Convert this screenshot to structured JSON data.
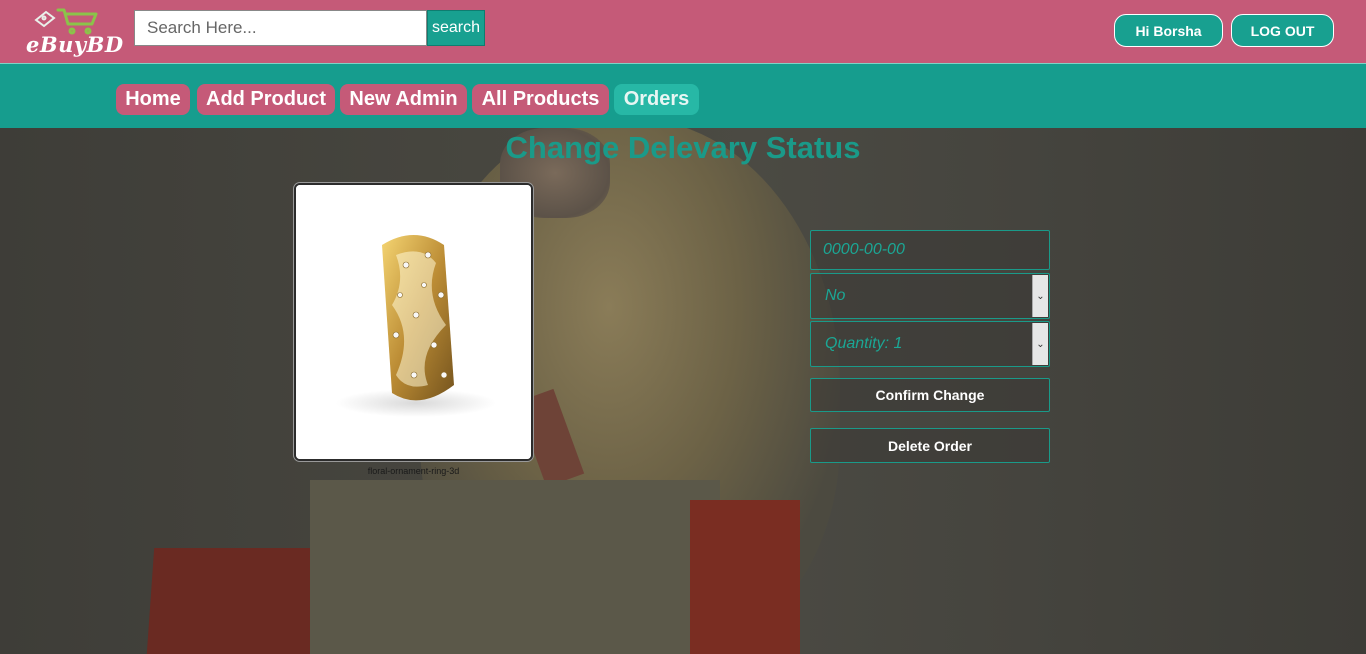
{
  "header": {
    "logo_text": "eBuyBD",
    "search": {
      "placeholder": "Search Here...",
      "button_label": "search"
    },
    "greeting": "Hi Borsha",
    "logout_label": "LOG OUT"
  },
  "nav": {
    "items": [
      {
        "label": "Home",
        "active": false
      },
      {
        "label": "Add Product",
        "active": false
      },
      {
        "label": "New Admin",
        "active": false
      },
      {
        "label": "All Products",
        "active": false
      },
      {
        "label": "Orders",
        "active": true
      }
    ]
  },
  "main": {
    "title": "Change Delevary Status",
    "product": {
      "image_caption": "floral-ornament-ring-3d"
    },
    "form": {
      "date_placeholder": "0000-00-00",
      "delivered_selected": "No",
      "quantity_selected": "Quantity: 1",
      "confirm_label": "Confirm Change",
      "delete_label": "Delete Order"
    }
  },
  "colors": {
    "header_bg": "#c55a78",
    "nav_bg": "#169d8e",
    "accent": "#1a9a89"
  },
  "icons": [
    "shopping-cart-icon",
    "tag-icon",
    "chevron-down-icon"
  ]
}
